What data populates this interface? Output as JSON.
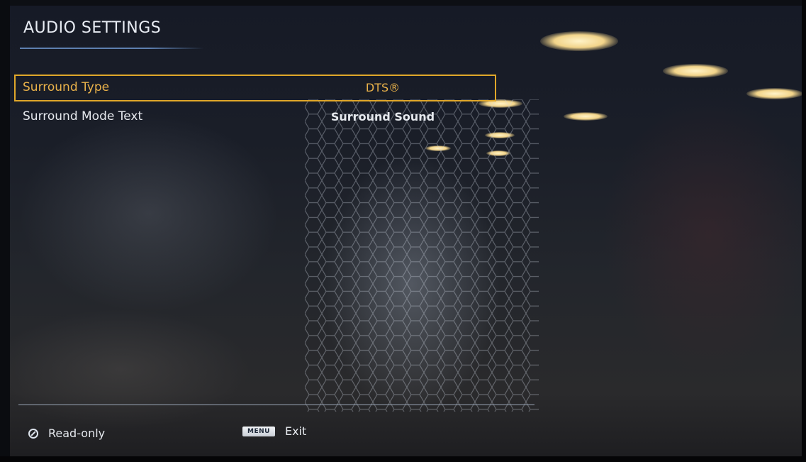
{
  "screen": {
    "title": "AUDIO SETTINGS",
    "accent_color": "#e0a72a",
    "rule_color": "#5d7fb0"
  },
  "settings": [
    {
      "label": "Surround Type",
      "value": "DTS®",
      "selected": true
    },
    {
      "label": "Surround Mode Text",
      "value": "Surround Sound",
      "selected": false
    }
  ],
  "footer": {
    "readonly_icon": "no-entry-icon",
    "readonly_label": "Read-only",
    "menu_key": "MENU",
    "exit_label": "Exit"
  }
}
